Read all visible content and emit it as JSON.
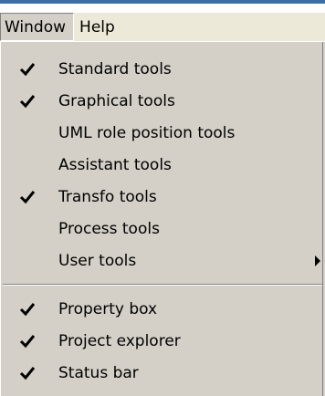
{
  "menubar": {
    "items": [
      {
        "label": "Window",
        "active": true
      },
      {
        "label": "Help",
        "active": false
      }
    ]
  },
  "menu": {
    "group1": [
      {
        "label": "Standard tools",
        "checked": true
      },
      {
        "label": "Graphical tools",
        "checked": true
      },
      {
        "label": "UML role position tools",
        "checked": false
      },
      {
        "label": "Assistant tools",
        "checked": false
      },
      {
        "label": "Transfo tools",
        "checked": true
      },
      {
        "label": "Process tools",
        "checked": false
      },
      {
        "label": "User tools",
        "checked": false,
        "submenu": true,
        "submenu_icon": "triangle-right-icon"
      }
    ],
    "group2": [
      {
        "label": "Property box",
        "checked": true
      },
      {
        "label": "Project explorer",
        "checked": true
      },
      {
        "label": "Status bar",
        "checked": true
      }
    ],
    "check_icon": "checkmark-icon"
  },
  "colors": {
    "menu_background": "#d4d0c8",
    "menubar_background": "#ece9d8",
    "title_accent": "#3a6ea5"
  }
}
